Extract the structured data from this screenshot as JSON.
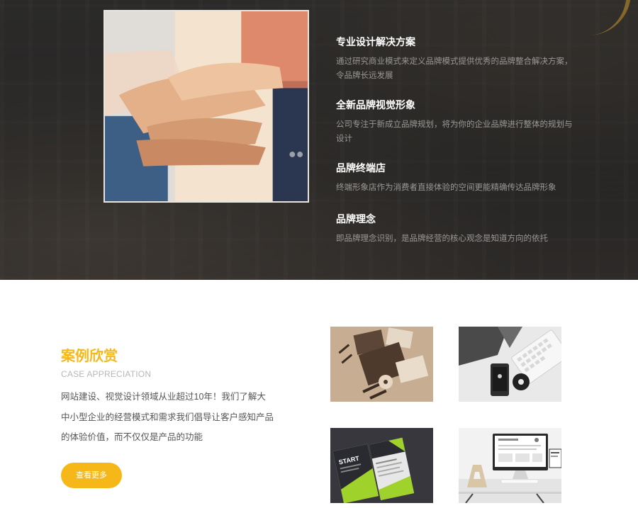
{
  "services": {
    "items": [
      {
        "title": "专业设计解决方案",
        "desc": "通过研究商业模式来定义品牌模式提供优秀的品牌整合解决方案，令品牌长远发展"
      },
      {
        "title": "全新品牌视觉形象",
        "desc": "公司专注于新成立品牌规划，将为你的企业品牌进行整体的规划与设计"
      },
      {
        "title": "品牌终端店",
        "desc": "终端形象店作为消费者直接体验的空间更能精确传达品牌形象"
      },
      {
        "title": "品牌理念",
        "desc": "即品牌理念识别，是品牌经营的核心观念是知道方向的依托"
      }
    ]
  },
  "cases": {
    "title": "案例欣赏",
    "subtitle": "CASE APPRECIATION",
    "desc": "网站建设、视觉设计领域从业超过10年！我们了解大中小型企业的经营模式和需求我们倡导让客户感知产品的体验价值，而不仅仅是产品的功能",
    "more_label": "查看更多",
    "thumb3_text": "START"
  },
  "colors": {
    "accent": "#f5b818",
    "dark_bg": "#2b2a29",
    "service_title": "#ffffff",
    "service_desc": "#9a9895"
  }
}
